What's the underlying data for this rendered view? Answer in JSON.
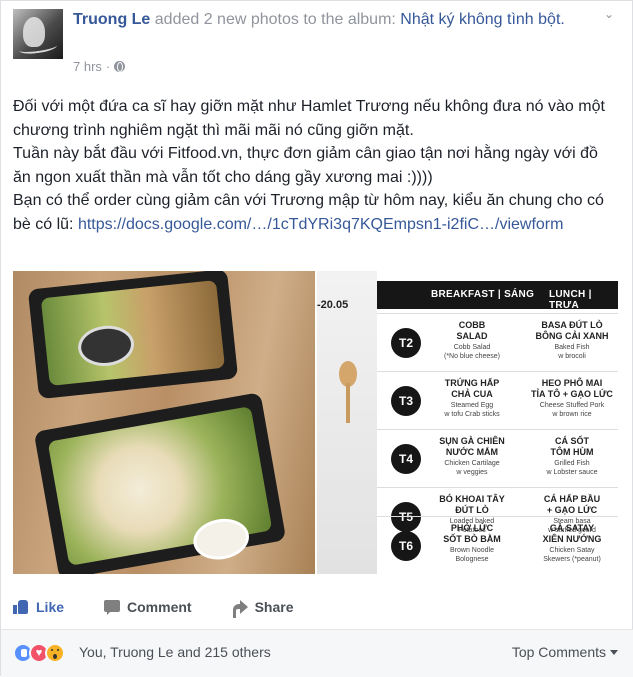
{
  "post": {
    "author": "Truong Le",
    "action": " added 2 new photos to the album: ",
    "album": "Nhật ký không tình bột.",
    "time": "7 hrs",
    "privacy_icon": "globe-icon",
    "text_lines": [
      "Đối với một đứa ca sĩ hay giỡn mặt như Hamlet Trương nếu không đưa nó vào một chương trình nghiêm ngặt thì mãi mãi nó cũng giỡn mặt.",
      "Tuần này bắt đầu với Fitfood.vn, thực đơn giảm cân giao tận nơi hằng ngày với đồ ăn ngon xuất thần mà vẫn tốt cho dáng gầy xương mai :))))"
    ],
    "text_last_prefix": "Bạn có thể order cùng giảm cân với Trương mập từ hôm nay, kiểu ăn chung cho có bè có lũ: ",
    "link": "https://docs.google.com/…/1cTdYRi3q7KQEmpsn1-i2fiC…/viewform"
  },
  "menu_image": {
    "date_text": "-20.05",
    "header_breakfast": "BREAKFAST | SÁNG",
    "header_lunch": "LUNCH | TRƯA",
    "rows": [
      {
        "day": "T2",
        "breakfast_vi": "COBB\nSALAD",
        "breakfast_en": "Cobb Salad\n(*No blue cheese)",
        "lunch_vi": "BASA ĐÚT LÒ\nBÔNG CẢI XANH",
        "lunch_en": "Baked Fish\nw brocoli"
      },
      {
        "day": "T3",
        "breakfast_vi": "TRỨNG HẤP\nCHẢ CUA",
        "breakfast_en": "Steamed Egg\nw tofu Crab sticks",
        "lunch_vi": "HEO PHÔ MAI\nTỈA TÔ + GẠO LỨC",
        "lunch_en": "Cheese Stuffed Pork\nw brown rice"
      },
      {
        "day": "T4",
        "breakfast_vi": "SỤN GÀ CHIÊN\nNƯỚC MẮM",
        "breakfast_en": "Chicken Cartilage\nw veggies",
        "lunch_vi": "CÁ SỐT\nTÔM HÙM",
        "lunch_en": "Grilled Fish\nw Lobster sauce"
      },
      {
        "day": "T5",
        "breakfast_vi": "BÓ KHOAI TÂY\nĐÚT LÒ",
        "breakfast_en": "Loaded baked\nPotatoes",
        "lunch_vi": "CÁ HẤP BẦU\n+ GẠO LỨC",
        "lunch_en": "Steam basa\nw stuffed gourd"
      },
      {
        "day": "T6",
        "breakfast_vi": "PHỞ LỨC\nSỐT BÒ BẰM",
        "breakfast_en": "Brown Noodle\nBolognese",
        "lunch_vi": "GÀ SATAY\nXIÊN NƯỚNG",
        "lunch_en": "Chicken Satay\nSkewers (*peanut)"
      }
    ]
  },
  "actions": {
    "like": "Like",
    "comment": "Comment",
    "share": "Share"
  },
  "footer": {
    "reactions_text": "You, Truong Le and 215 others",
    "top_comments": "Top Comments"
  }
}
